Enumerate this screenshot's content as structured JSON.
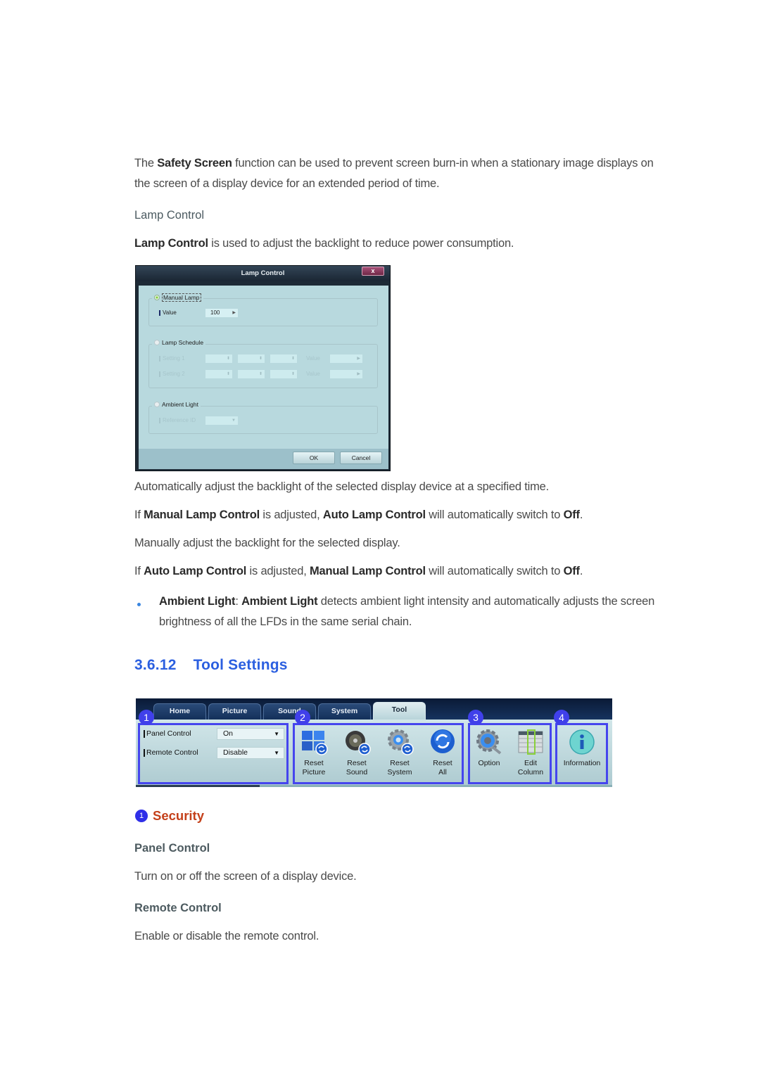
{
  "intro": {
    "p1_prefix": "The ",
    "p1_bold": "Safety Screen",
    "p1_rest": " function can be used to prevent screen burn-in when a stationary image displays on",
    "p1_line2": "the screen of a display device for an extended period of time."
  },
  "lamp_control": {
    "heading": "Lamp Control",
    "desc_bold": "Lamp Control",
    "desc_rest": " is used to adjust the backlight to reduce power consumption."
  },
  "lamp_dialog": {
    "title": "Lamp Control",
    "close_label": "x",
    "manual_lamp": {
      "label": "Manual Lamp",
      "selected": true,
      "value_label": "Value",
      "value": "100"
    },
    "lamp_schedule": {
      "label": "Lamp Schedule",
      "selected": false,
      "settings": [
        {
          "label": "Setting 1",
          "value_label": "Value"
        },
        {
          "label": "Setting 2",
          "value_label": "Value"
        }
      ]
    },
    "ambient_light": {
      "label": "Ambient Light",
      "selected": false,
      "reference_label": "Reference ID"
    },
    "ok_label": "OK",
    "cancel_label": "Cancel"
  },
  "body_text": {
    "auto_adjust": "Automatically adjust the backlight of the selected display device at a specified time.",
    "manual_note": {
      "if": "If ",
      "b1": "Manual Lamp Control",
      "mid": " is adjusted, ",
      "b2": "Auto Lamp Control",
      "end": " will automatically switch to ",
      "b3": "Off",
      "dot": "."
    },
    "manual_adjust": "Manually adjust the backlight for the selected display.",
    "auto_note": {
      "if": "If ",
      "b1": "Auto Lamp Control",
      "mid": " is adjusted, ",
      "b2": "Manual Lamp Control",
      "end": " will automatically switch to ",
      "b3": "Off",
      "dot": "."
    },
    "bullet": {
      "b1": "Ambient Light",
      "colon": ": ",
      "b2": "Ambient Light",
      "rest": " detects ambient light intensity and automatically adjusts the screen",
      "line2": "brightness of all the LFDs in the same serial chain."
    }
  },
  "tool_settings": {
    "number": "3.6.12",
    "title": "Tool Settings"
  },
  "ribbon": {
    "tabs": [
      {
        "label": "Home",
        "active": false
      },
      {
        "label": "Picture",
        "active": false
      },
      {
        "label": "Sound",
        "active": false
      },
      {
        "label": "System",
        "active": false
      },
      {
        "label": "Tool",
        "active": true
      }
    ],
    "callouts": [
      "1",
      "2",
      "3",
      "4"
    ],
    "security": {
      "panel_control_label": "Panel Control",
      "panel_control_value": "On",
      "remote_control_label": "Remote Control",
      "remote_control_value": "Disable"
    },
    "reset_buttons": [
      {
        "line1": "Reset",
        "line2": "Picture",
        "icon": "reset-picture-icon"
      },
      {
        "line1": "Reset",
        "line2": "Sound",
        "icon": "reset-sound-icon"
      },
      {
        "line1": "Reset",
        "line2": "System",
        "icon": "reset-system-icon"
      },
      {
        "line1": "Reset",
        "line2": "All",
        "icon": "reset-all-icon"
      }
    ],
    "option_buttons": [
      {
        "line1": "Option",
        "line2": "",
        "icon": "option-gear-icon"
      },
      {
        "line1": "Edit",
        "line2": "Column",
        "icon": "edit-column-icon"
      }
    ],
    "info_button": {
      "line1": "Information",
      "icon": "information-icon"
    }
  },
  "security_section": {
    "badge": "1",
    "title": "Security",
    "panel_control": {
      "heading": "Panel Control",
      "desc": "Turn on or off the screen of a display device."
    },
    "remote_control": {
      "heading": "Remote Control",
      "desc": "Enable or disable the remote control."
    }
  },
  "colors": {
    "section_title": "#2b5fe0",
    "security_title": "#c4401a",
    "callout": "#4040ea",
    "bullet": "#3a86e0"
  }
}
